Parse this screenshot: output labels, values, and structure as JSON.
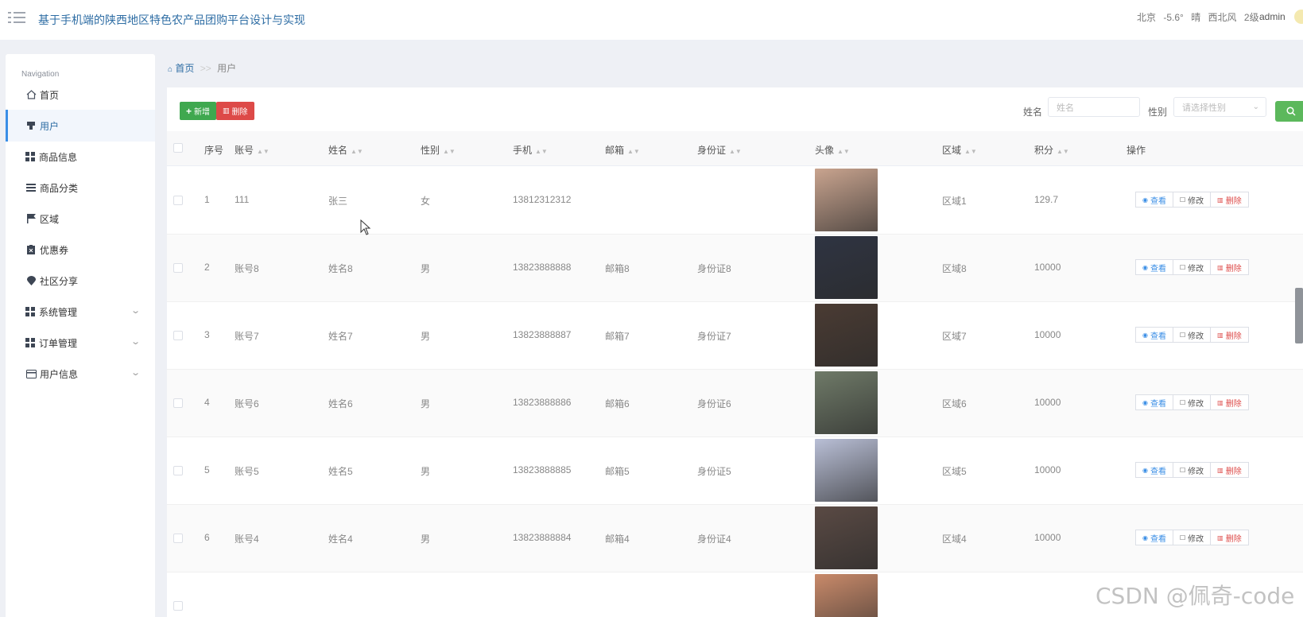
{
  "header": {
    "app_title": "基于手机端的陕西地区特色农产品团购平台设计与实现",
    "weather": {
      "city": "北京",
      "temp": "-5.6°",
      "condition": "晴",
      "wind": "西北风",
      "level": "2级"
    },
    "user": "admin"
  },
  "sidebar": {
    "caption": "Navigation",
    "items": [
      {
        "label": "首页",
        "icon": "home-icon"
      },
      {
        "label": "用户",
        "icon": "user-icon",
        "active": true
      },
      {
        "label": "商品信息",
        "icon": "grid-icon"
      },
      {
        "label": "商品分类",
        "icon": "list-icon"
      },
      {
        "label": "区域",
        "icon": "flag-icon"
      },
      {
        "label": "优惠券",
        "icon": "coupon-icon"
      },
      {
        "label": "社区分享",
        "icon": "pin-icon"
      },
      {
        "label": "系统管理",
        "icon": "grid-icon",
        "expandable": true
      },
      {
        "label": "订单管理",
        "icon": "grid-icon",
        "expandable": true
      },
      {
        "label": "用户信息",
        "icon": "card-icon",
        "expandable": true
      }
    ]
  },
  "breadcrumb": {
    "home": "首页",
    "separator": ">>",
    "current": "用户"
  },
  "toolbar": {
    "add_label": "新增",
    "delete_label": "删除",
    "name_label": "姓名",
    "name_placeholder": "姓名",
    "gender_label": "性别",
    "gender_placeholder": "请选择性别"
  },
  "table": {
    "columns": [
      "序号",
      "账号",
      "姓名",
      "性别",
      "手机",
      "邮箱",
      "身份证",
      "头像",
      "区域",
      "积分",
      "操作"
    ],
    "actions": {
      "view": "查看",
      "edit": "修改",
      "delete": "删除"
    },
    "rows": [
      {
        "index": "1",
        "account": "111",
        "name": "张三",
        "gender": "女",
        "phone": "13812312312",
        "email": "",
        "id_card": "",
        "region": "区域1",
        "points": "129.7",
        "avatar_color": "#c9a48f"
      },
      {
        "index": "2",
        "account": "账号8",
        "name": "姓名8",
        "gender": "男",
        "phone": "13823888888",
        "email": "邮箱8",
        "id_card": "身份证8",
        "region": "区域8",
        "points": "10000",
        "avatar_color": "#2f3442"
      },
      {
        "index": "3",
        "account": "账号7",
        "name": "姓名7",
        "gender": "男",
        "phone": "13823888887",
        "email": "邮箱7",
        "id_card": "身份证7",
        "region": "区域7",
        "points": "10000",
        "avatar_color": "#4a3b33"
      },
      {
        "index": "4",
        "account": "账号6",
        "name": "姓名6",
        "gender": "男",
        "phone": "13823888886",
        "email": "邮箱6",
        "id_card": "身份证6",
        "region": "区域6",
        "points": "10000",
        "avatar_color": "#6f7a68"
      },
      {
        "index": "5",
        "account": "账号5",
        "name": "姓名5",
        "gender": "男",
        "phone": "13823888885",
        "email": "邮箱5",
        "id_card": "身份证5",
        "region": "区域5",
        "points": "10000",
        "avatar_color": "#b9bfd6"
      },
      {
        "index": "6",
        "account": "账号4",
        "name": "姓名4",
        "gender": "男",
        "phone": "13823888884",
        "email": "邮箱4",
        "id_card": "身份证4",
        "region": "区域4",
        "points": "10000",
        "avatar_color": "#5a4a44"
      },
      {
        "index": "",
        "account": "",
        "name": "",
        "gender": "",
        "phone": "",
        "email": "",
        "id_card": "",
        "region": "",
        "points": "",
        "avatar_color": "#c98a6a"
      }
    ]
  },
  "watermark": "CSDN @佩奇-code",
  "colors": {
    "primary": "#2e6da4",
    "add": "#3fa84f",
    "delete": "#dd4a48",
    "search": "#5cb85c"
  }
}
